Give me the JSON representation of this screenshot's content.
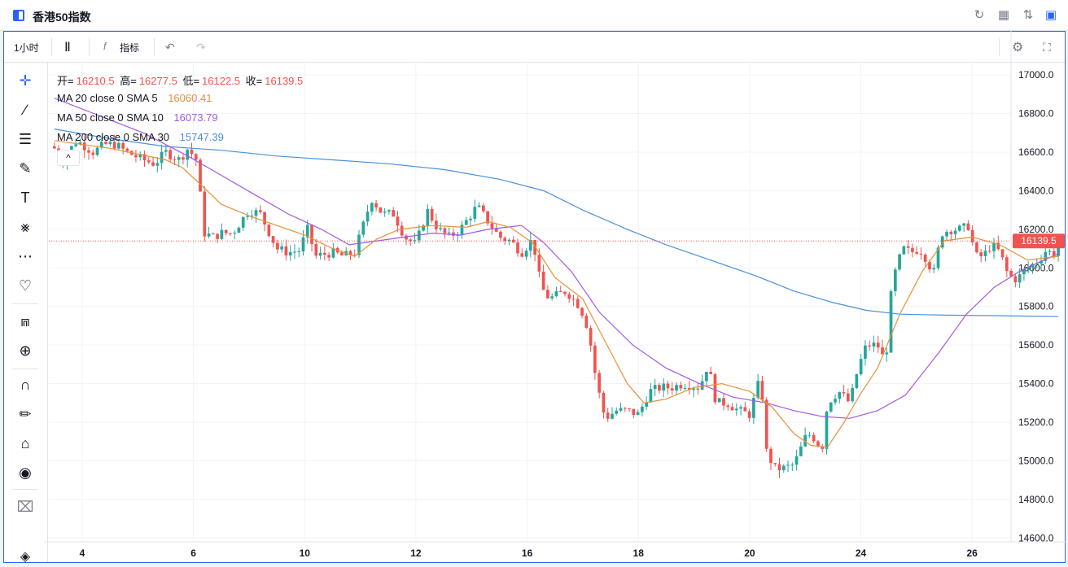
{
  "window": {
    "title": "香港50指数",
    "icons": [
      "sidebar-toggle-icon",
      "refresh-icon",
      "layout-icon",
      "compare-icon",
      "panel-icon"
    ]
  },
  "toolbar": {
    "interval": "1小时",
    "indicators_label": "指标",
    "icons": [
      "candles-icon",
      "fx-icon",
      "undo-icon",
      "redo-icon",
      "settings-icon",
      "fullscreen-icon"
    ]
  },
  "left_tools": [
    "crosshair-icon",
    "trendline-icon",
    "fib-icon",
    "brush-icon",
    "text-icon",
    "pattern-icon",
    "forecast-icon",
    "heart-icon",
    "ruler-icon",
    "zoom-in-icon",
    "magnet-icon",
    "lock-draw-icon",
    "lock-icon",
    "eye-icon",
    "trash-icon"
  ],
  "ohlc": {
    "open_label": "开=",
    "open": "16210.5",
    "high_label": "高=",
    "high": "16277.5",
    "low_label": "低=",
    "low": "16122.5",
    "close_label": "收=",
    "close": "16139.5",
    "value_color": "#ef5350"
  },
  "indicators": [
    {
      "label": "MA 20 close 0 SMA 5",
      "value": "16060.41",
      "color": "#e69138"
    },
    {
      "label": "MA 50 close 0 SMA 10",
      "value": "16073.79",
      "color": "#a259e6"
    },
    {
      "label": "MA 200 close 0 SMA 30",
      "value": "15747.39",
      "color": "#4a90d9"
    }
  ],
  "collapse_glyph": "^",
  "chart_data": {
    "type": "candlestick",
    "up_color": "#26a69a",
    "down_color": "#ef5350",
    "last_price": "16139.5",
    "last_price_value": 16139.5,
    "ylim": [
      14580,
      17060
    ],
    "y_ticks": [
      "17000.0",
      "16800.0",
      "16600.0",
      "16400.0",
      "16200.0",
      "16000.0",
      "15800.0",
      "15600.0",
      "15400.0",
      "15200.0",
      "15000.0",
      "14800.0",
      "14600.0"
    ],
    "x_ticks": [
      "4",
      "6",
      "10",
      "12",
      "16",
      "18",
      "20",
      "24",
      "26"
    ],
    "x_tick_positions": [
      0.5,
      2.5,
      4.5,
      6.5,
      8.5,
      10.5,
      12.5,
      14.5,
      16.5
    ],
    "x_range": [
      -0.1,
      17.2
    ],
    "close_path": [
      [
        0.0,
        16620
      ],
      [
        0.15,
        16560
      ],
      [
        0.4,
        16660
      ],
      [
        0.7,
        16600
      ],
      [
        0.9,
        16640
      ],
      [
        1.1,
        16640
      ],
      [
        1.3,
        16600
      ],
      [
        1.6,
        16560
      ],
      [
        1.8,
        16540
      ],
      [
        2.0,
        16600
      ],
      [
        2.25,
        16560
      ],
      [
        2.4,
        16620
      ],
      [
        2.55,
        16560
      ],
      [
        2.7,
        16180
      ],
      [
        2.85,
        16160
      ],
      [
        3.0,
        16180
      ],
      [
        3.2,
        16180
      ],
      [
        3.5,
        16300
      ],
      [
        3.7,
        16280
      ],
      [
        4.0,
        16100
      ],
      [
        4.2,
        16080
      ],
      [
        4.4,
        16090
      ],
      [
        4.55,
        16200
      ],
      [
        4.7,
        16060
      ],
      [
        5.0,
        16080
      ],
      [
        5.2,
        16060
      ],
      [
        5.4,
        16080
      ],
      [
        5.7,
        16360
      ],
      [
        5.9,
        16280
      ],
      [
        6.1,
        16280
      ],
      [
        6.3,
        16160
      ],
      [
        6.5,
        16120
      ],
      [
        6.7,
        16300
      ],
      [
        6.9,
        16200
      ],
      [
        7.1,
        16160
      ],
      [
        7.3,
        16200
      ],
      [
        7.6,
        16320
      ],
      [
        7.8,
        16240
      ],
      [
        8.0,
        16160
      ],
      [
        8.2,
        16140
      ],
      [
        8.4,
        16080
      ],
      [
        8.6,
        16150
      ],
      [
        8.75,
        15900
      ],
      [
        8.9,
        15840
      ],
      [
        9.2,
        15880
      ],
      [
        9.45,
        15800
      ],
      [
        9.6,
        15680
      ],
      [
        9.75,
        15400
      ],
      [
        9.9,
        15220
      ],
      [
        10.1,
        15260
      ],
      [
        10.3,
        15260
      ],
      [
        10.5,
        15240
      ],
      [
        10.7,
        15360
      ],
      [
        10.9,
        15380
      ],
      [
        11.1,
        15380
      ],
      [
        11.3,
        15400
      ],
      [
        11.6,
        15380
      ],
      [
        11.75,
        15500
      ],
      [
        11.9,
        15300
      ],
      [
        12.1,
        15300
      ],
      [
        12.3,
        15260
      ],
      [
        12.5,
        15240
      ],
      [
        12.7,
        15440
      ],
      [
        12.8,
        15050
      ],
      [
        12.95,
        14960
      ],
      [
        13.1,
        14960
      ],
      [
        13.3,
        14980
      ],
      [
        13.5,
        15120
      ],
      [
        13.6,
        15140
      ],
      [
        13.8,
        15060
      ],
      [
        13.9,
        15300
      ],
      [
        14.1,
        15360
      ],
      [
        14.3,
        15300
      ],
      [
        14.45,
        15480
      ],
      [
        14.6,
        15600
      ],
      [
        14.8,
        15600
      ],
      [
        14.95,
        15500
      ],
      [
        15.0,
        15780
      ],
      [
        15.1,
        15960
      ],
      [
        15.25,
        16100
      ],
      [
        15.4,
        16080
      ],
      [
        15.55,
        16100
      ],
      [
        15.7,
        16040
      ],
      [
        15.8,
        15960
      ],
      [
        15.95,
        16180
      ],
      [
        16.1,
        16200
      ],
      [
        16.3,
        16200
      ],
      [
        16.45,
        16220
      ],
      [
        16.55,
        16060
      ],
      [
        16.7,
        16060
      ],
      [
        16.85,
        16120
      ],
      [
        17.0,
        16080
      ],
      [
        17.15,
        15960
      ],
      [
        17.3,
        15940
      ],
      [
        17.5,
        16000
      ],
      [
        17.7,
        16040
      ],
      [
        17.85,
        16100
      ],
      [
        17.95,
        16060
      ],
      [
        18.05,
        16139.5
      ]
    ],
    "ma20": [
      [
        0.0,
        16660
      ],
      [
        1.0,
        16620
      ],
      [
        2.0,
        16560
      ],
      [
        2.3,
        16520
      ],
      [
        2.6,
        16440
      ],
      [
        3.0,
        16330
      ],
      [
        3.5,
        16270
      ],
      [
        4.0,
        16220
      ],
      [
        4.5,
        16170
      ],
      [
        5.0,
        16100
      ],
      [
        5.4,
        16060
      ],
      [
        5.8,
        16150
      ],
      [
        6.2,
        16200
      ],
      [
        6.8,
        16220
      ],
      [
        7.4,
        16210
      ],
      [
        7.8,
        16240
      ],
      [
        8.2,
        16210
      ],
      [
        8.6,
        16130
      ],
      [
        9.0,
        15950
      ],
      [
        9.5,
        15840
      ],
      [
        9.9,
        15620
      ],
      [
        10.3,
        15400
      ],
      [
        10.6,
        15300
      ],
      [
        11.0,
        15320
      ],
      [
        11.5,
        15380
      ],
      [
        12.0,
        15400
      ],
      [
        12.5,
        15360
      ],
      [
        12.9,
        15280
      ],
      [
        13.3,
        15140
      ],
      [
        13.6,
        15080
      ],
      [
        13.9,
        15070
      ],
      [
        14.2,
        15200
      ],
      [
        14.5,
        15350
      ],
      [
        14.8,
        15480
      ],
      [
        15.2,
        15760
      ],
      [
        15.6,
        15980
      ],
      [
        16.0,
        16140
      ],
      [
        16.5,
        16160
      ],
      [
        17.0,
        16120
      ],
      [
        17.5,
        16040
      ],
      [
        18.05,
        16060.41
      ]
    ],
    "ma50": [
      [
        0.0,
        16880
      ],
      [
        0.8,
        16790
      ],
      [
        1.6,
        16700
      ],
      [
        2.4,
        16580
      ],
      [
        3.0,
        16480
      ],
      [
        3.6,
        16380
      ],
      [
        4.2,
        16280
      ],
      [
        4.8,
        16200
      ],
      [
        5.3,
        16120
      ],
      [
        5.8,
        16140
      ],
      [
        6.3,
        16160
      ],
      [
        6.8,
        16180
      ],
      [
        7.3,
        16170
      ],
      [
        7.8,
        16200
      ],
      [
        8.4,
        16220
      ],
      [
        8.8,
        16130
      ],
      [
        9.3,
        15980
      ],
      [
        9.8,
        15770
      ],
      [
        10.4,
        15600
      ],
      [
        11.0,
        15480
      ],
      [
        11.6,
        15400
      ],
      [
        12.2,
        15330
      ],
      [
        12.8,
        15300
      ],
      [
        13.3,
        15260
      ],
      [
        13.8,
        15230
      ],
      [
        14.3,
        15220
      ],
      [
        14.8,
        15260
      ],
      [
        15.3,
        15340
      ],
      [
        15.9,
        15560
      ],
      [
        16.4,
        15760
      ],
      [
        16.9,
        15900
      ],
      [
        17.4,
        15990
      ],
      [
        18.05,
        16073.79
      ]
    ],
    "ma200": [
      [
        0.0,
        16720
      ],
      [
        1.0,
        16670
      ],
      [
        2.0,
        16630
      ],
      [
        3.0,
        16610
      ],
      [
        4.0,
        16580
      ],
      [
        5.0,
        16560
      ],
      [
        6.0,
        16540
      ],
      [
        7.0,
        16510
      ],
      [
        8.0,
        16460
      ],
      [
        8.8,
        16400
      ],
      [
        9.5,
        16300
      ],
      [
        10.3,
        16200
      ],
      [
        11.0,
        16120
      ],
      [
        11.8,
        16040
      ],
      [
        12.6,
        15960
      ],
      [
        13.3,
        15880
      ],
      [
        14.0,
        15820
      ],
      [
        14.6,
        15780
      ],
      [
        15.2,
        15760
      ],
      [
        16.0,
        15755
      ],
      [
        17.0,
        15752
      ],
      [
        18.05,
        15747.39
      ]
    ]
  }
}
